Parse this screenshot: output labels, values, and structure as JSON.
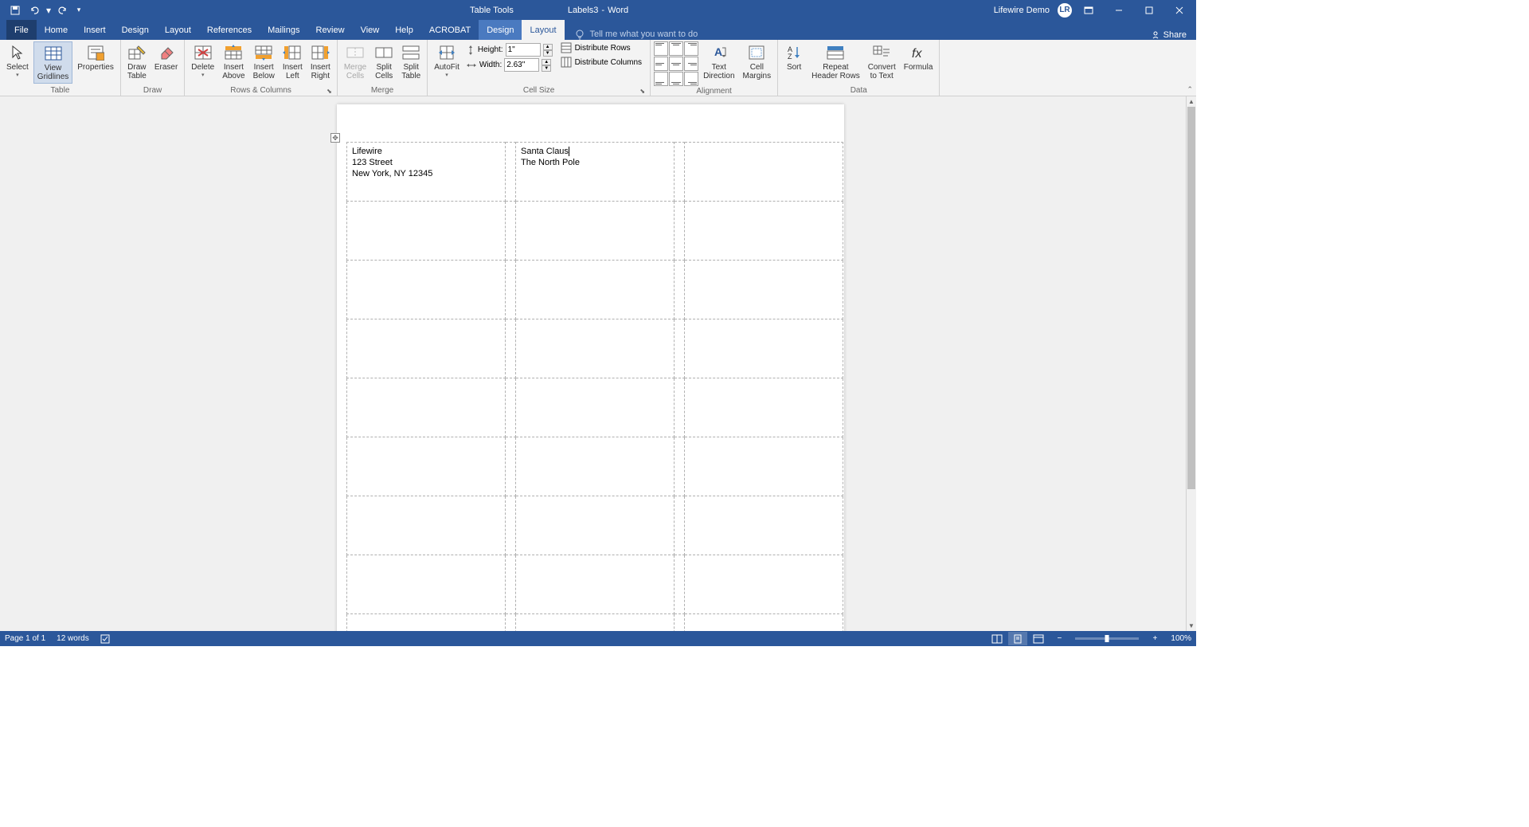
{
  "title": {
    "tabletools": "Table Tools",
    "doc": "Labels3",
    "sep": "-",
    "app": "Word"
  },
  "user": {
    "name": "Lifewire Demo",
    "initials": "LR"
  },
  "tabs": {
    "file": "File",
    "home": "Home",
    "insert": "Insert",
    "design1": "Design",
    "layout1": "Layout",
    "references": "References",
    "mailings": "Mailings",
    "review": "Review",
    "view": "View",
    "help": "Help",
    "acrobat": "ACROBAT",
    "design2": "Design",
    "layout2": "Layout",
    "tellme": "Tell me what you want to do",
    "share": "Share"
  },
  "ribbon": {
    "table": {
      "label": "Table",
      "select": "Select",
      "gridlines": "View\nGridlines",
      "properties": "Properties"
    },
    "draw": {
      "label": "Draw",
      "drawtable": "Draw\nTable",
      "eraser": "Eraser"
    },
    "rowscols": {
      "label": "Rows & Columns",
      "delete": "Delete",
      "above": "Insert\nAbove",
      "below": "Insert\nBelow",
      "left": "Insert\nLeft",
      "right": "Insert\nRight"
    },
    "merge": {
      "label": "Merge",
      "mergecells": "Merge\nCells",
      "splitcells": "Split\nCells",
      "splittable": "Split\nTable"
    },
    "cellsize": {
      "label": "Cell Size",
      "autofit": "AutoFit",
      "height_label": "Height:",
      "height_value": "1\"",
      "width_label": "Width:",
      "width_value": "2.63\"",
      "distrows": "Distribute Rows",
      "distcols": "Distribute Columns"
    },
    "alignment": {
      "label": "Alignment",
      "textdir": "Text\nDirection",
      "cellmargins": "Cell\nMargins"
    },
    "data": {
      "label": "Data",
      "sort": "Sort",
      "repeat": "Repeat\nHeader Rows",
      "convert": "Convert\nto Text",
      "formula": "Formula"
    }
  },
  "labels": {
    "cell1": {
      "line1": "Lifewire",
      "line2": "123 Street",
      "line3": "New York, NY 12345"
    },
    "cell2": {
      "line1": "Santa Claus",
      "line2": "The North Pole"
    }
  },
  "status": {
    "page": "Page 1 of 1",
    "words": "12 words",
    "zoom": "100%"
  }
}
